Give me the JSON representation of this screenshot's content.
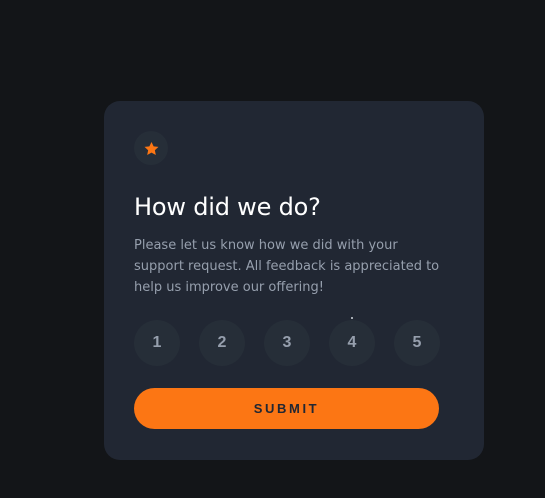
{
  "card": {
    "icon": "star-icon",
    "title": "How did we do?",
    "description": "Please let us know how we did with your support request. All feedback is appreciated to help us improve our offering!",
    "ratings": [
      "1",
      "2",
      "3",
      "4",
      "5"
    ],
    "submit_label": "SUBMIT"
  },
  "colors": {
    "page_background": "#131518",
    "card_background": "#212733",
    "circle_background": "#262e38",
    "accent": "#fc7614",
    "muted_text": "#969fad",
    "title_text": "#ffffff"
  }
}
